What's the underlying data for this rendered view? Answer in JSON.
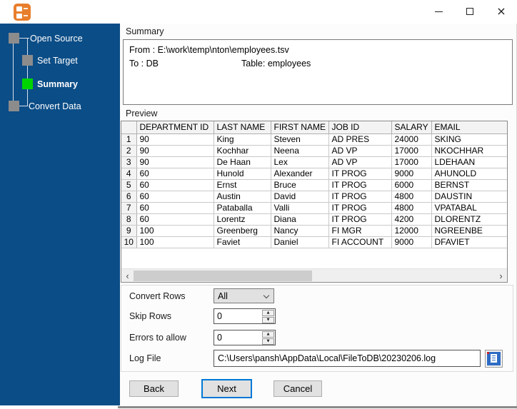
{
  "window": {
    "close_glyph": "×"
  },
  "sidebar": {
    "bg_color": "#0B4D87",
    "active_step_color": "#00D500",
    "inactive_step_color": "#8C8C8C",
    "steps": [
      {
        "label": "Open Source",
        "active": false
      },
      {
        "label": "Set Target",
        "active": false
      },
      {
        "label": "Summary",
        "active": true
      },
      {
        "label": "Convert Data",
        "active": false
      }
    ]
  },
  "summary": {
    "section_label": "Summary",
    "from_line": "From : E:\\work\\temp\\nton\\employees.tsv",
    "to_label": "To : DB",
    "table_label": "Table: employees"
  },
  "preview": {
    "section_label": "Preview",
    "columns": [
      "",
      "DEPARTMENT ID",
      "LAST NAME",
      "FIRST NAME",
      "JOB ID",
      "SALARY",
      "EMAIL"
    ],
    "rows": [
      [
        "1",
        "90",
        "King",
        "Steven",
        "AD PRES",
        "24000",
        "SKING"
      ],
      [
        "2",
        "90",
        "Kochhar",
        "Neena",
        "AD VP",
        "17000",
        "NKOCHHAR"
      ],
      [
        "3",
        "90",
        "De Haan",
        "Lex",
        "AD VP",
        "17000",
        "LDEHAAN"
      ],
      [
        "4",
        "60",
        "Hunold",
        "Alexander",
        "IT PROG",
        "9000",
        "AHUNOLD"
      ],
      [
        "5",
        "60",
        "Ernst",
        "Bruce",
        "IT PROG",
        "6000",
        "BERNST"
      ],
      [
        "6",
        "60",
        "Austin",
        "David",
        "IT PROG",
        "4800",
        "DAUSTIN"
      ],
      [
        "7",
        "60",
        "Pataballa",
        "Valli",
        "IT PROG",
        "4800",
        "VPATABAL"
      ],
      [
        "8",
        "60",
        "Lorentz",
        "Diana",
        "IT PROG",
        "4200",
        "DLORENTZ"
      ],
      [
        "9",
        "100",
        "Greenberg",
        "Nancy",
        "FI MGR",
        "12000",
        "NGREENBE"
      ],
      [
        "10",
        "100",
        "Faviet",
        "Daniel",
        "FI ACCOUNT",
        "9000",
        "DFAVIET"
      ]
    ],
    "scrollbar": {
      "left_arrow": "‹",
      "right_arrow": "›"
    }
  },
  "form": {
    "convert_rows": {
      "label": "Convert Rows",
      "value": "All"
    },
    "skip_rows": {
      "label": "Skip Rows",
      "value": "0"
    },
    "errors_to_allow": {
      "label": "Errors to allow",
      "value": "0"
    },
    "log_file": {
      "label": "Log File",
      "value": "C:\\Users\\pansh\\AppData\\Local\\FileToDB\\20230206.log"
    }
  },
  "buttons": {
    "back": "Back",
    "next": "Next",
    "cancel": "Cancel"
  },
  "accent": {
    "next_button_border": "#0078D7",
    "app_icon_orange": "#E87E2B"
  }
}
